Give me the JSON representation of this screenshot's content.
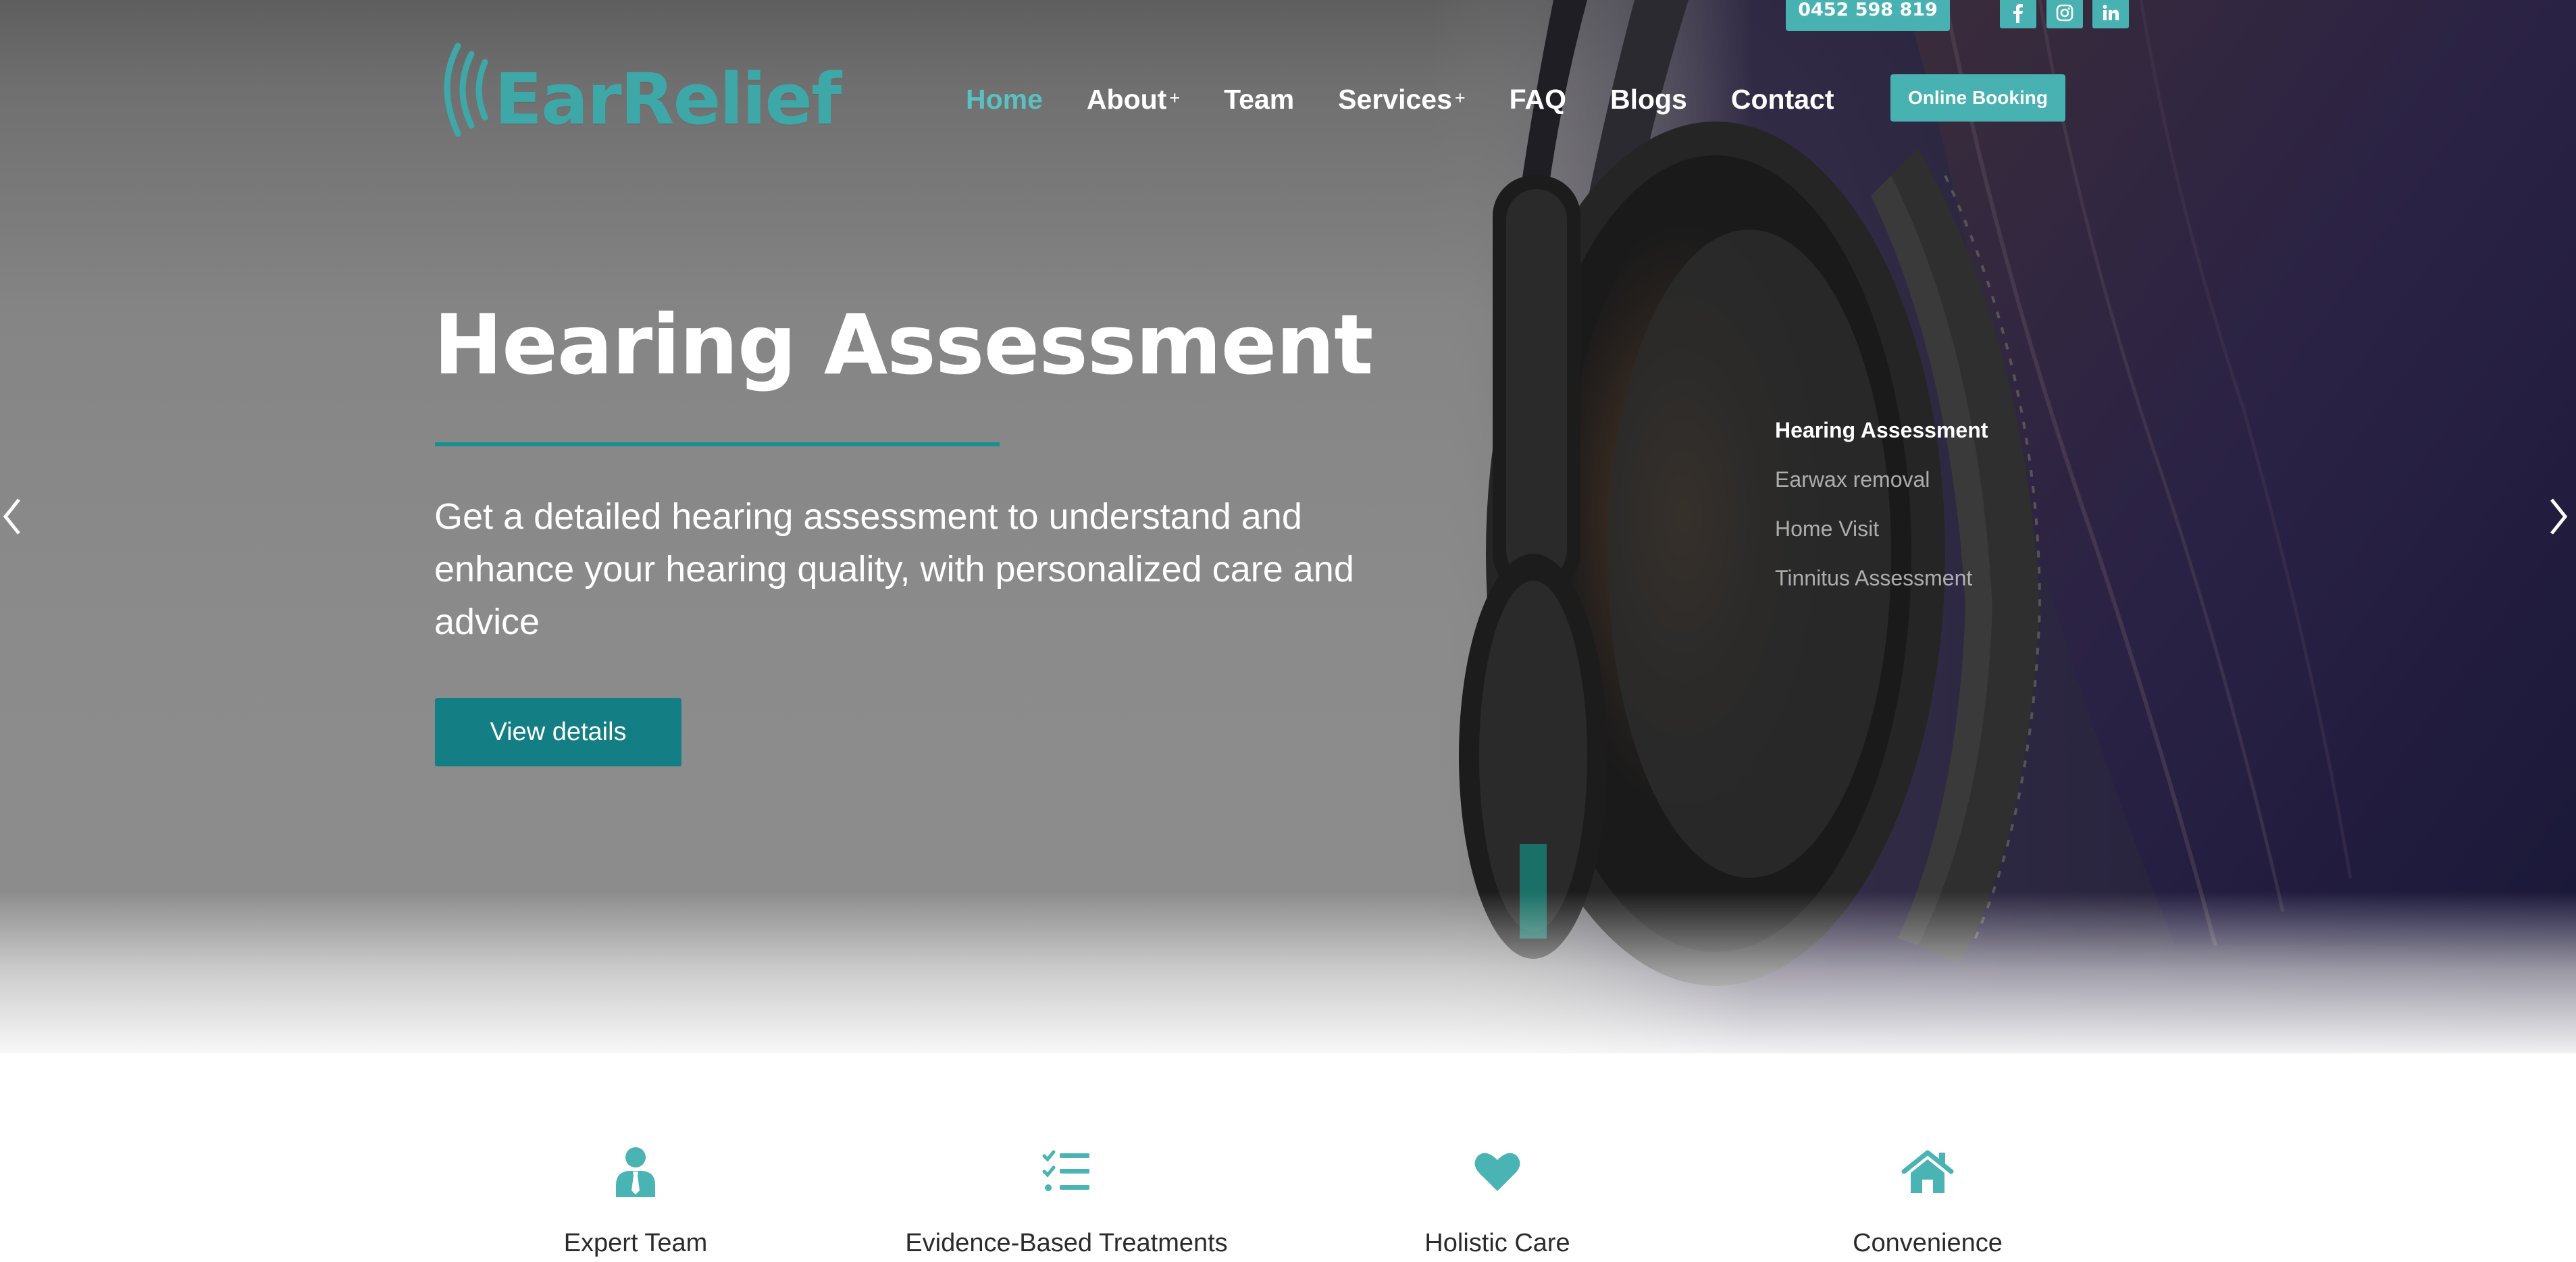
{
  "topbar": {
    "phone": "0452 598 819",
    "social": [
      {
        "icon": "facebook-icon",
        "glyph": "f"
      },
      {
        "icon": "instagram-icon",
        "glyph": ""
      },
      {
        "icon": "linkedin-icon",
        "glyph": "in"
      }
    ]
  },
  "logo": {
    "text": "EarRelief"
  },
  "nav": {
    "items": [
      {
        "label": "Home",
        "active": true,
        "has_submenu": false
      },
      {
        "label": "About",
        "active": false,
        "has_submenu": true
      },
      {
        "label": "Team",
        "active": false,
        "has_submenu": false
      },
      {
        "label": "Services",
        "active": false,
        "has_submenu": true
      },
      {
        "label": "FAQ",
        "active": false,
        "has_submenu": false
      },
      {
        "label": "Blogs",
        "active": false,
        "has_submenu": false
      },
      {
        "label": "Contact",
        "active": false,
        "has_submenu": false
      }
    ],
    "submenu_marker": "+",
    "booking_label": "Online Booking"
  },
  "hero": {
    "title": "Hearing Assessment",
    "description": "Get a detailed hearing assessment to understand and enhance your hearing quality, with personalized care and advice",
    "button_label": "View details",
    "slides": [
      {
        "label": "Hearing Assessment",
        "active": true
      },
      {
        "label": "Earwax removal",
        "active": false
      },
      {
        "label": "Home Visit",
        "active": false
      },
      {
        "label": "Tinnitus Assessment",
        "active": false
      }
    ],
    "prev_icon": "chevron-left-icon",
    "next_icon": "chevron-right-icon"
  },
  "features": [
    {
      "icon": "person-icon",
      "label": "Expert Team"
    },
    {
      "icon": "checklist-icon",
      "label": "Evidence-Based Treatments"
    },
    {
      "icon": "heart-icon",
      "label": "Holistic Care"
    },
    {
      "icon": "home-icon",
      "label": "Convenience"
    }
  ],
  "colors": {
    "accent": "#48b2b2",
    "accent_dark": "#137e83",
    "nav_active": "#5cc0c0",
    "feature_icon": "#4ab3b3",
    "text_dark": "#2b2b2b"
  }
}
